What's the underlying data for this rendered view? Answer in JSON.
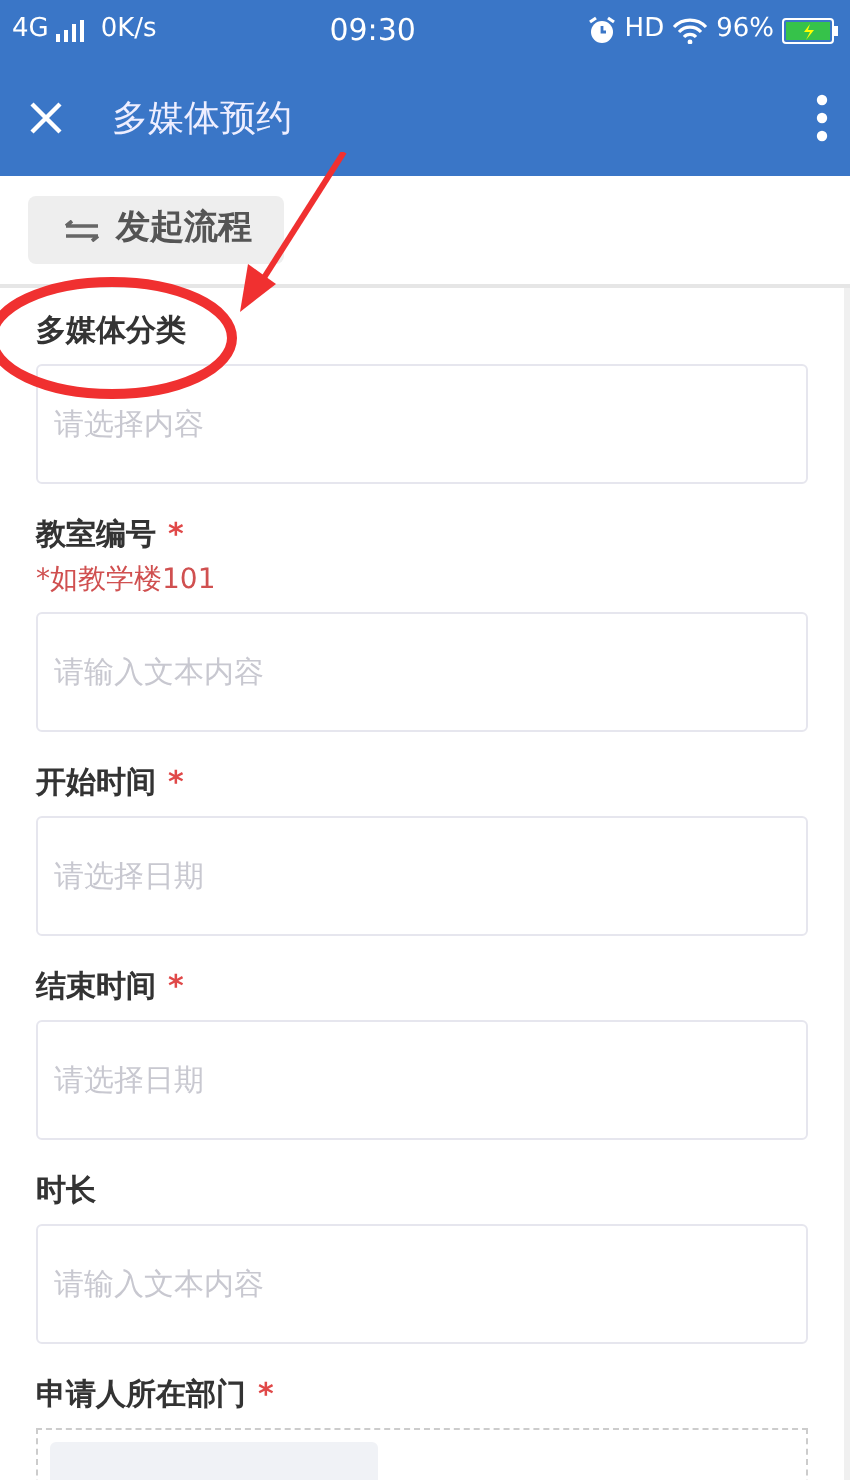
{
  "status_bar": {
    "network": "4G",
    "speed": "0K/s",
    "time": "09:30",
    "hd": "HD",
    "battery": "96%"
  },
  "app_bar": {
    "title": "多媒体预约"
  },
  "toolbar": {
    "button": "发起流程"
  },
  "fields": [
    {
      "kind": "input",
      "label": "多媒体分类",
      "placeholder": "请选择内容",
      "highlighted": true
    },
    {
      "kind": "input",
      "label": "教室编号",
      "required_mark": "*",
      "hint": "*如教学楼101",
      "placeholder": "请输入文本内容",
      "highlighted": false
    },
    {
      "kind": "input",
      "label": "开始时间",
      "required_mark": "*",
      "placeholder": "请选择日期",
      "highlighted": false
    },
    {
      "kind": "input",
      "label": "结束时间",
      "required_mark": "*",
      "placeholder": "请选择日期",
      "highlighted": false
    },
    {
      "kind": "input",
      "label": "时长",
      "placeholder": "请输入文本内容",
      "highlighted": false
    },
    {
      "kind": "picker",
      "label": "申请人所在部门",
      "required_mark": "*",
      "highlighted": false
    }
  ]
}
